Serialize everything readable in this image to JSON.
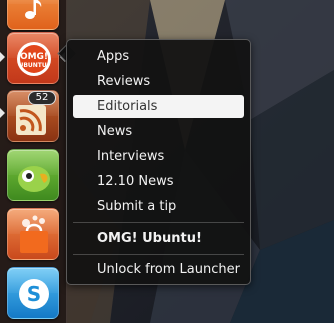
{
  "launcher": {
    "icons": [
      {
        "name": "music-player-icon",
        "color": "#f07a2a"
      },
      {
        "name": "omg-ubuntu-icon",
        "color": "#d9471c",
        "logo_text_1": "OMG!",
        "logo_text_2": "UBUNTU!"
      },
      {
        "name": "rss-reader-icon",
        "color": "#a0451f",
        "badge_count": "52"
      },
      {
        "name": "parrot-chat-icon",
        "color": "#5fae2e"
      },
      {
        "name": "shopping-bag-icon",
        "color": "#e0612a"
      },
      {
        "name": "skype-icon",
        "color": "#1d9be2"
      }
    ]
  },
  "quicklist": {
    "items": [
      {
        "label": "Apps"
      },
      {
        "label": "Reviews"
      },
      {
        "label": "Editorials",
        "highlighted": true
      },
      {
        "label": "News"
      },
      {
        "label": "Interviews"
      },
      {
        "label": "12.10 News"
      },
      {
        "label": "Submit a tip"
      }
    ],
    "app_title": "OMG! Ubuntu!",
    "unlock_label": "Unlock from Launcher"
  }
}
